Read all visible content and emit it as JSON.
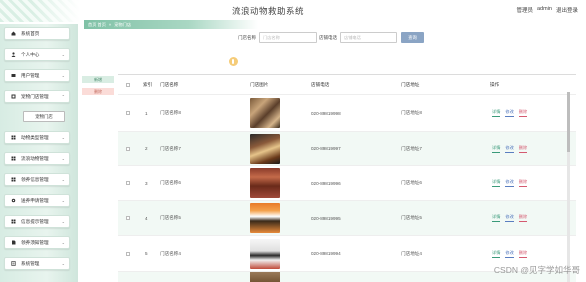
{
  "header": {
    "title": "流浪动物救助系统",
    "role": "管理员",
    "username": "admin",
    "logout": "退出登录"
  },
  "breadcrumb": {
    "home": "首页 首页",
    "sep": "»",
    "current": "宠物门店"
  },
  "search": {
    "name_label": "门店名称",
    "name_placeholder": "门店名称",
    "phone_label": "店铺电话",
    "phone_placeholder": "店铺电话",
    "button": "查询"
  },
  "actions": {
    "add": "新增",
    "delete": "删除"
  },
  "sidebar": {
    "items": [
      {
        "label": "系统首页",
        "icon": "home-icon"
      },
      {
        "label": "个人中心",
        "icon": "user-icon"
      },
      {
        "label": "用户管理",
        "icon": "folder-icon"
      },
      {
        "label": "宠物门店管理",
        "icon": "tag-icon"
      },
      {
        "label": "动物类型管理",
        "icon": "grid-icon"
      },
      {
        "label": "流浪动物管理",
        "icon": "grid-icon"
      },
      {
        "label": "领养信息管理",
        "icon": "grid-icon"
      },
      {
        "label": "送养申请管理",
        "icon": "settings-icon"
      },
      {
        "label": "信息提示管理",
        "icon": "grid-icon"
      },
      {
        "label": "领养须知管理",
        "icon": "file-icon"
      },
      {
        "label": "系统管理",
        "icon": "doc-icon"
      }
    ],
    "sub_item": "宠物门店"
  },
  "table": {
    "headers": [
      "",
      "索引",
      "门店名称",
      "门店图片",
      "店铺电话",
      "门店地址",
      "操作"
    ],
    "rows": [
      {
        "index": "1",
        "name": "门店名称8",
        "phone": "020-89819998",
        "address": "门店地址8"
      },
      {
        "index": "2",
        "name": "门店名称7",
        "phone": "020-89819997",
        "address": "门店地址7"
      },
      {
        "index": "3",
        "name": "门店名称6",
        "phone": "020-89819996",
        "address": "门店地址6"
      },
      {
        "index": "4",
        "name": "门店名称5",
        "phone": "020-89819995",
        "address": "门店地址5"
      },
      {
        "index": "5",
        "name": "门店名称4",
        "phone": "020-89819994",
        "address": "门店地址4"
      }
    ],
    "ops": {
      "detail": "详情",
      "edit": "修改",
      "delete": "删除"
    }
  },
  "watermark": "CSDN @见字学如华哥",
  "colors": {
    "accent": "#7fc1a6",
    "sidebar_bg": "#d7ece3",
    "search_button": "#8aa4c4"
  }
}
